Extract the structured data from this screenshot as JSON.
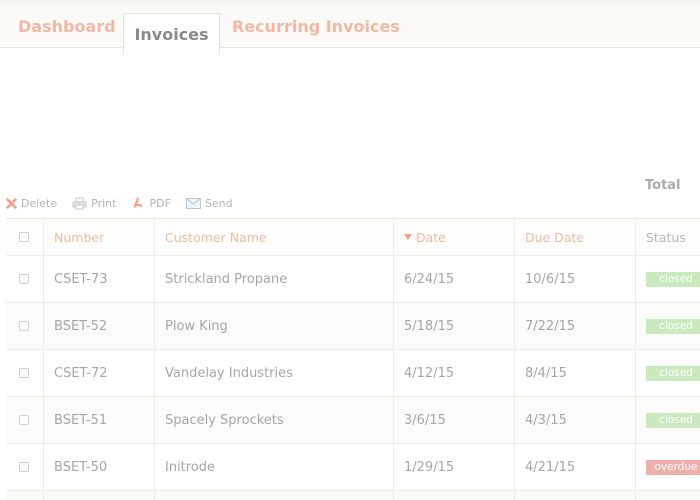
{
  "tabs": {
    "dashboard": "Dashboard",
    "invoices": "Invoices",
    "recurring": "Recurring Invoices"
  },
  "summary": {
    "total_label": "Total"
  },
  "toolbar": {
    "delete": "Delete",
    "print": "Print",
    "pdf": "PDF",
    "send": "Send"
  },
  "table": {
    "headers": {
      "number": "Number",
      "customer": "Customer Name",
      "date": "Date",
      "due": "Due Date",
      "status": "Status"
    },
    "sort_column": "date",
    "rows": [
      {
        "number": "CSET-73",
        "customer": "Strickland Propane",
        "date": "6/24/15",
        "due": "10/6/15",
        "status": "closed"
      },
      {
        "number": "BSET-52",
        "customer": "Plow King",
        "date": "5/18/15",
        "due": "7/22/15",
        "status": "closed"
      },
      {
        "number": "CSET-72",
        "customer": "Vandelay Industries",
        "date": "4/12/15",
        "due": "8/4/15",
        "status": "closed"
      },
      {
        "number": "BSET-51",
        "customer": "Spacely Sprockets",
        "date": "3/6/15",
        "due": "4/3/15",
        "status": "closed"
      },
      {
        "number": "BSET-50",
        "customer": "Initrode",
        "date": "1/29/15",
        "due": "4/21/15",
        "status": "overdue"
      }
    ]
  },
  "colors": {
    "accent": "#f2b8a6",
    "closed": "#cbe9bf",
    "overdue": "#efafaa"
  }
}
